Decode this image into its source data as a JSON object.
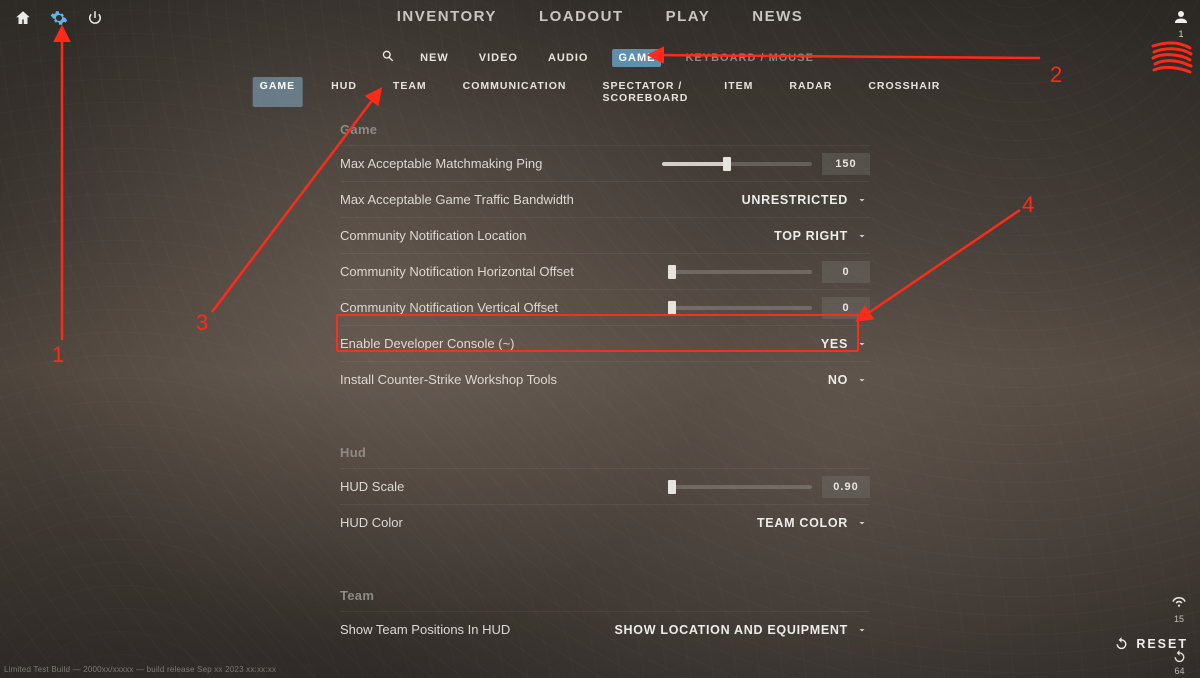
{
  "main_nav": {
    "inventory": "INVENTORY",
    "loadout": "LOADOUT",
    "play": "PLAY",
    "news": "NEWS"
  },
  "sub_nav": {
    "new": "NEW",
    "video": "VIDEO",
    "audio": "AUDIO",
    "game": "GAME",
    "kbm": "KEYBOARD / MOUSE"
  },
  "cat_nav": {
    "game": "GAME",
    "hud": "HUD",
    "team": "TEAM",
    "comm": "COMMUNICATION",
    "spec": "SPECTATOR / SCOREBOARD",
    "item": "ITEM",
    "radar": "RADAR",
    "cross": "CROSSHAIR"
  },
  "sections": {
    "game": "Game",
    "hud": "Hud",
    "team": "Team"
  },
  "rows": {
    "ping_label": "Max Acceptable Matchmaking Ping",
    "ping_value": "150",
    "bandwidth_label": "Max Acceptable Game Traffic Bandwidth",
    "bandwidth_value": "UNRESTRICTED",
    "notif_loc_label": "Community Notification Location",
    "notif_loc_value": "TOP RIGHT",
    "notif_h_label": "Community Notification Horizontal Offset",
    "notif_h_value": "0",
    "notif_v_label": "Community Notification Vertical Offset",
    "notif_v_value": "0",
    "devcon_label": "Enable Developer Console (~)",
    "devcon_value": "YES",
    "workshop_label": "Install Counter-Strike Workshop Tools",
    "workshop_value": "NO",
    "hudscale_label": "HUD Scale",
    "hudscale_value": "0.90",
    "hudcolor_label": "HUD Color",
    "hudcolor_value": "TEAM COLOR",
    "teampos_label": "Show Team Positions In HUD",
    "teampos_value": "SHOW LOCATION AND EQUIPMENT"
  },
  "reset_label": "RESET",
  "side": {
    "friends": "1",
    "ping": "15",
    "latency": "64"
  },
  "build_string": "Limited Test Build — 2000xx/xxxxx — build release Sep xx 2023 xx:xx:xx",
  "annotations": {
    "a1": "1",
    "a2": "2",
    "a3": "3",
    "a4": "4"
  }
}
